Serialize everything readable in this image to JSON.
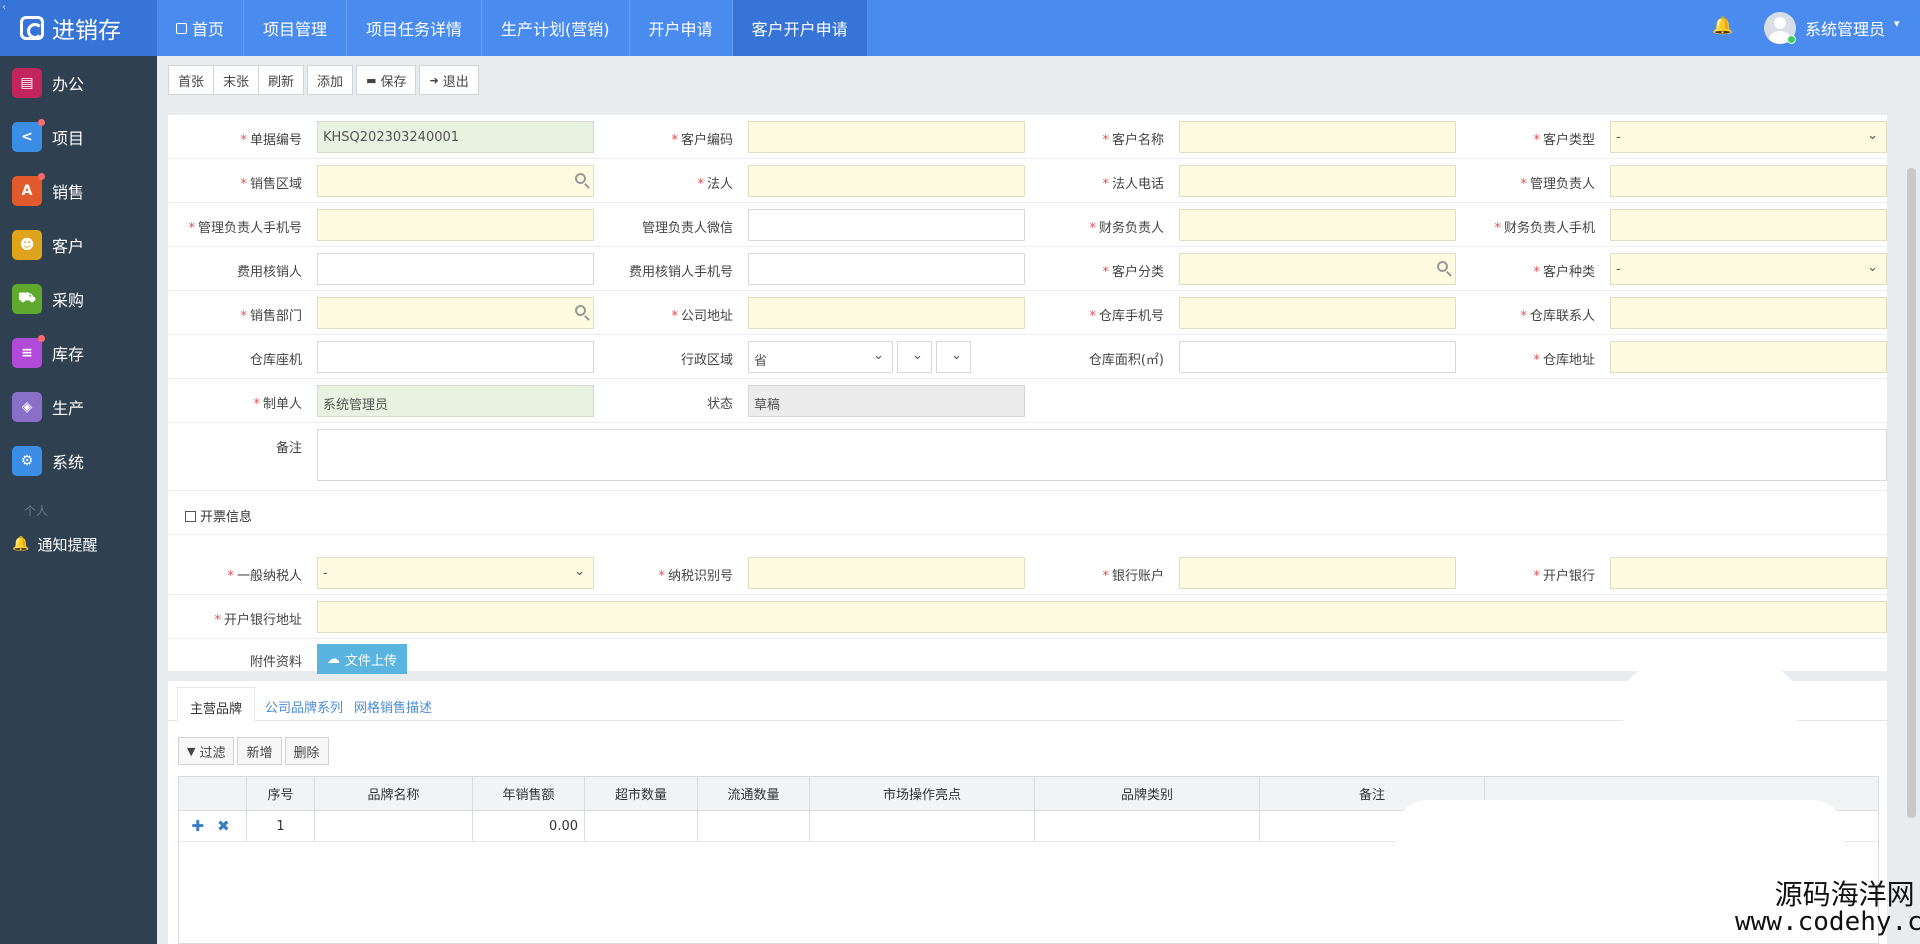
{
  "brand": {
    "title": "进销存",
    "logo_icon": "cube-logo-icon",
    "toggle_icon": "chevron-left-icon"
  },
  "topnav": {
    "items": [
      {
        "label": "首页",
        "icon": "square-icon"
      },
      {
        "label": "项目管理"
      },
      {
        "label": "项目任务详情"
      },
      {
        "label": "生产计划(营销)"
      },
      {
        "label": "开户申请"
      },
      {
        "label": "客户开户申请",
        "active": true
      }
    ],
    "user": "系统管理员",
    "bell_icon": "bell-icon",
    "caret": "▾"
  },
  "sidebar": {
    "items": [
      {
        "label": "办公",
        "icon": "document-icon",
        "color": "#c2255c",
        "dot": false
      },
      {
        "label": "项目",
        "icon": "share-icon",
        "color": "#3a8ee6",
        "dot": true
      },
      {
        "label": "销售",
        "icon": "road-icon",
        "color": "#e05a2b",
        "dot": true
      },
      {
        "label": "客户",
        "icon": "users-icon",
        "color": "#e0a31c",
        "dot": false
      },
      {
        "label": "采购",
        "icon": "cart-icon",
        "color": "#5ea92e",
        "dot": false
      },
      {
        "label": "库存",
        "icon": "database-icon",
        "color": "#b24ad8",
        "dot": true
      },
      {
        "label": "生产",
        "icon": "cube-icon",
        "color": "#8a6fc9",
        "dot": false
      },
      {
        "label": "系统",
        "icon": "gears-icon",
        "color": "#3a8ee6",
        "dot": false
      }
    ],
    "section": "个人",
    "notify": "通知提醒"
  },
  "toolbar": {
    "first": "首张",
    "last": "末张",
    "refresh": "刷新",
    "add": "添加",
    "save": "保存",
    "exit": "退出"
  },
  "form": {
    "order_no": {
      "label": "单据编号",
      "value": "KHSQ202303240001"
    },
    "customer_code": {
      "label": "客户编码"
    },
    "customer_name": {
      "label": "客户名称"
    },
    "customer_type": {
      "label": "客户类型",
      "value": "-"
    },
    "sales_region": {
      "label": "销售区域"
    },
    "legal_person": {
      "label": "法人"
    },
    "legal_phone": {
      "label": "法人电话"
    },
    "manager": {
      "label": "管理负责人"
    },
    "manager_mobile": {
      "label": "管理负责人手机号"
    },
    "manager_wechat": {
      "label": "管理负责人微信"
    },
    "finance": {
      "label": "财务负责人"
    },
    "finance_mobile": {
      "label": "财务负责人手机"
    },
    "expense_person": {
      "label": "费用核销人"
    },
    "expense_mobile": {
      "label": "费用核销人手机号"
    },
    "customer_category": {
      "label": "客户分类"
    },
    "customer_kind": {
      "label": "客户种类",
      "value": "-"
    },
    "sales_dept": {
      "label": "销售部门"
    },
    "company_address": {
      "label": "公司地址"
    },
    "warehouse_mobile": {
      "label": "仓库手机号"
    },
    "warehouse_contact": {
      "label": "仓库联系人"
    },
    "warehouse_phone": {
      "label": "仓库座机"
    },
    "admin_region": {
      "label": "行政区域",
      "province": "省"
    },
    "warehouse_area": {
      "label": "仓库面积(㎡)"
    },
    "warehouse_address": {
      "label": "仓库地址"
    },
    "creator": {
      "label": "制单人",
      "value": "系统管理员"
    },
    "status": {
      "label": "状态",
      "value": "草稿"
    },
    "remark": {
      "label": "备注"
    }
  },
  "invoice": {
    "title": "开票信息",
    "taxpayer": {
      "label": "一般纳税人",
      "value": "-"
    },
    "tax_id": {
      "label": "纳税识别号"
    },
    "bank_account": {
      "label": "银行账户"
    },
    "bank": {
      "label": "开户银行"
    },
    "bank_address": {
      "label": "开户银行地址"
    },
    "attachment": {
      "label": "附件资料",
      "button": "文件上传",
      "icon": "cloud-upload-icon"
    }
  },
  "tabs": [
    {
      "label": "主营品牌",
      "active": true
    },
    {
      "label": "公司品牌系列"
    },
    {
      "label": "网格销售描述"
    }
  ],
  "grid_toolbar": {
    "filter": "过滤",
    "add": "新增",
    "delete": "删除"
  },
  "grid": {
    "columns": [
      "序号",
      "品牌名称",
      "年销售额",
      "超市数量",
      "流通数量",
      "市场操作亮点",
      "品牌类别",
      "备注"
    ],
    "rows": [
      {
        "no": "1",
        "name": "",
        "sales": "0.00",
        "ops": "✚ ✖"
      }
    ]
  },
  "watermark": {
    "line1": "源码海洋网",
    "line2": "www.codehy.com"
  }
}
